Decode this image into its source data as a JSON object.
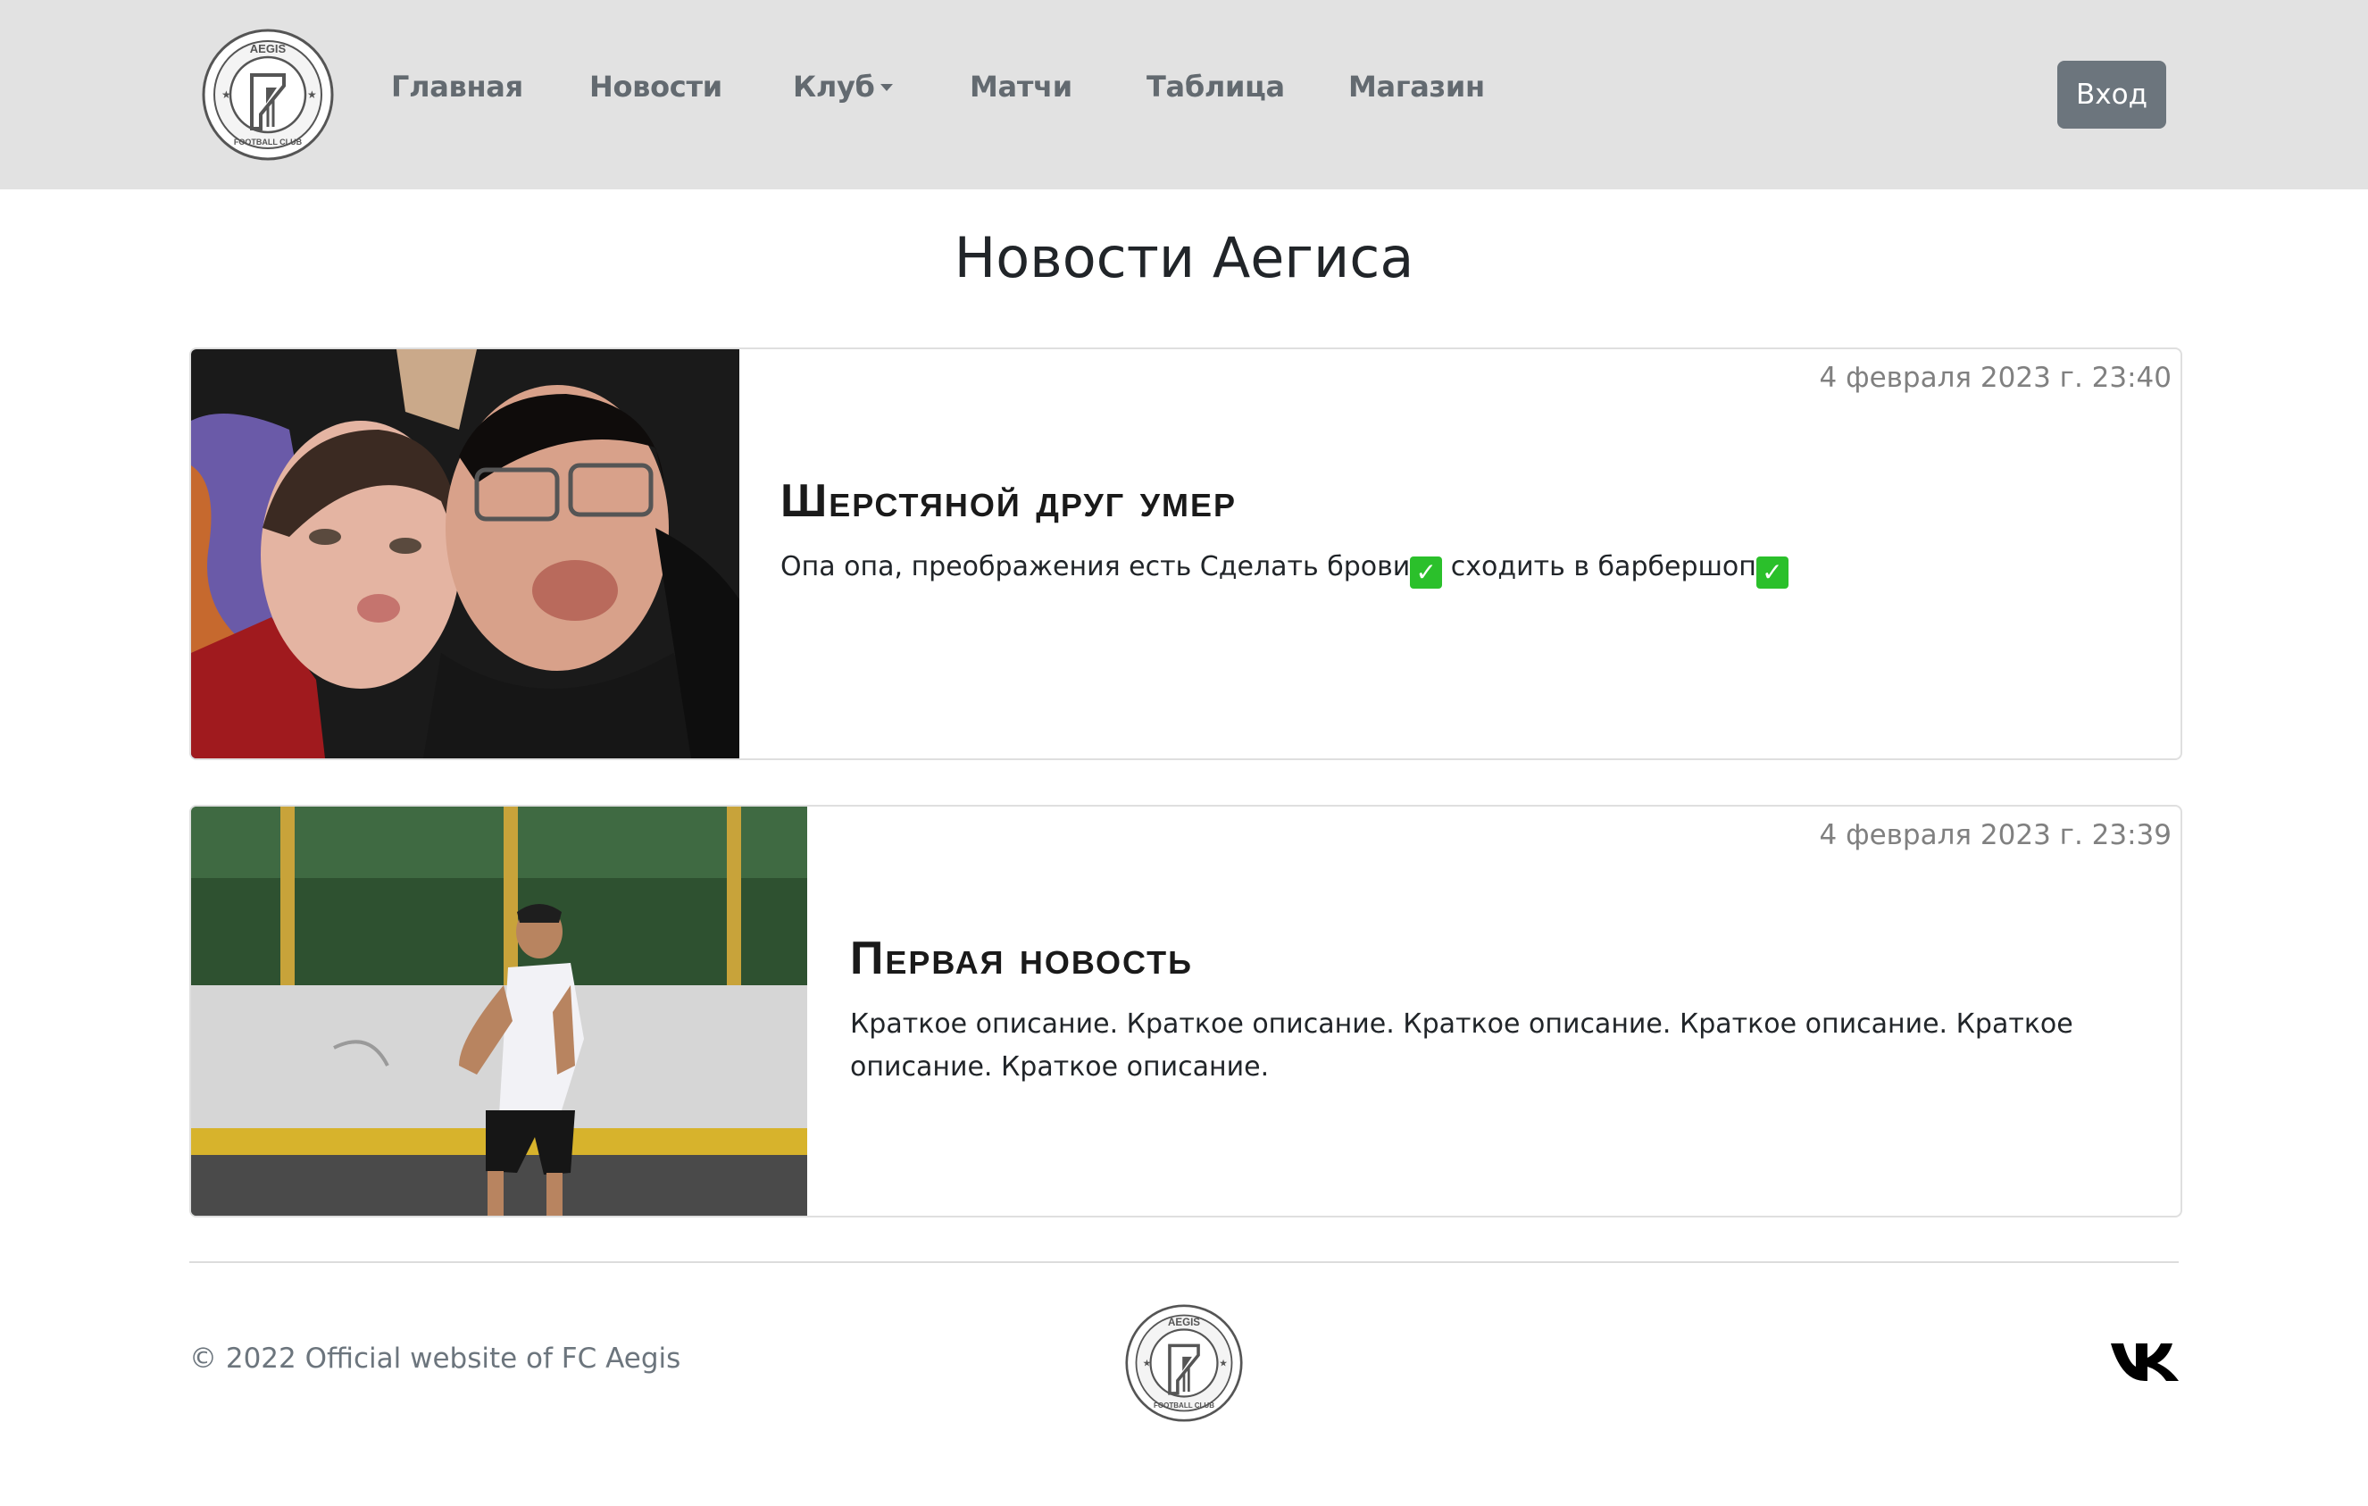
{
  "navbar": {
    "logo_text": {
      "top": "AEGIS",
      "bottom": "FOOTBALL CLUB"
    },
    "items": [
      {
        "label": "Главная"
      },
      {
        "label": "Новости"
      },
      {
        "label": "Клуб",
        "dropdown": true
      },
      {
        "label": "Матчи"
      },
      {
        "label": "Таблица"
      },
      {
        "label": "Магазин"
      }
    ],
    "login_label": "Вход"
  },
  "page": {
    "title": "Новости Аегиса"
  },
  "news": [
    {
      "date": "4 февраля 2023 г. 23:40",
      "title": "Шерстяной друг умер",
      "description_parts": [
        "Опа опа, преображения есть Сделать брови",
        " сходить в барбершоп"
      ]
    },
    {
      "date": "4 февраля 2023 г. 23:39",
      "title": "Первая новость",
      "description": "Краткое описание. Краткое описание. Краткое описание. Краткое описание. Краткое описание. Краткое описание."
    }
  ],
  "footer": {
    "copyright": "© 2022 Official website of FC Aegis",
    "social_icon": "vk-icon"
  },
  "colors": {
    "navbar_bg": "#e2e2e2",
    "nav_text": "#636a70",
    "button_bg": "#6c757d",
    "check_green": "#2bc02b"
  }
}
